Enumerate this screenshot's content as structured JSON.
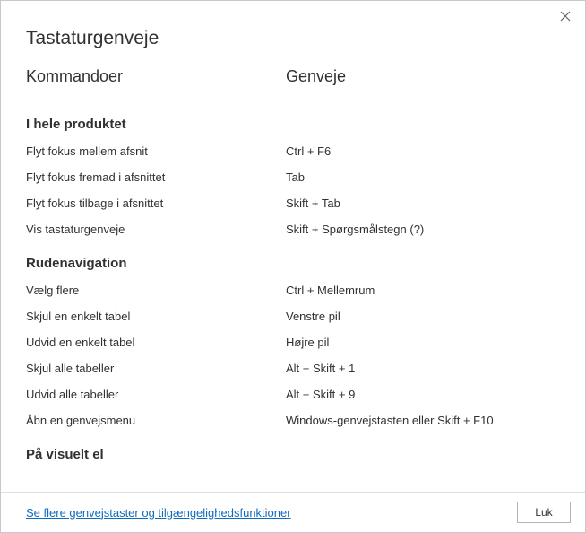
{
  "title": "Tastaturgenveje",
  "columns": {
    "commands": "Kommandoer",
    "shortcuts": "Genveje"
  },
  "sections": [
    {
      "title": "I hele produktet",
      "rows": [
        {
          "cmd": "Flyt fokus mellem afsnit",
          "shortcut": "Ctrl + F6"
        },
        {
          "cmd": "Flyt fokus fremad i afsnittet",
          "shortcut": "Tab"
        },
        {
          "cmd": "Flyt fokus tilbage i afsnittet",
          "shortcut": "Skift + Tab"
        },
        {
          "cmd": "Vis tastaturgenveje",
          "shortcut": "Skift + Spørgsmålstegn (?)"
        }
      ]
    },
    {
      "title": "Rudenavigation",
      "rows": [
        {
          "cmd": "Vælg flere",
          "shortcut": "Ctrl + Mellemrum"
        },
        {
          "cmd": "Skjul en enkelt tabel",
          "shortcut": "Venstre pil"
        },
        {
          "cmd": "Udvid en enkelt tabel",
          "shortcut": "Højre pil"
        },
        {
          "cmd": "Skjul alle tabeller",
          "shortcut": "Alt + Skift + 1"
        },
        {
          "cmd": "Udvid alle tabeller",
          "shortcut": "Alt + Skift + 9"
        },
        {
          "cmd": "Åbn en genvejsmenu",
          "shortcut": "Windows-genvejstasten eller Skift + F10"
        }
      ]
    },
    {
      "title": "På visuelt el",
      "rows": []
    }
  ],
  "footer": {
    "link": "Se flere genvejstaster og tilgængelighedsfunktioner",
    "close": "Luk"
  }
}
